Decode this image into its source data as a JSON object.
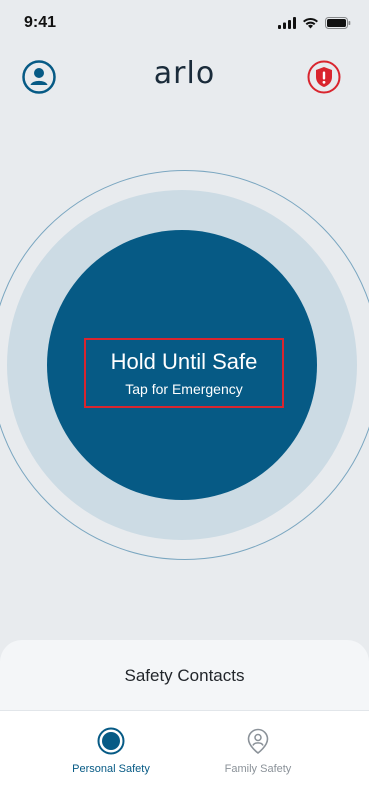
{
  "status_bar": {
    "time": "9:41"
  },
  "header": {
    "logo_text": "arlo"
  },
  "dial": {
    "title": "Hold Until Safe",
    "subtitle": "Tap for Emergency"
  },
  "contacts": {
    "title": "Safety Contacts"
  },
  "tabs": [
    {
      "label": "Personal Safety",
      "icon": "personal-safety-icon",
      "active": true
    },
    {
      "label": "Family Safety",
      "icon": "family-safety-icon",
      "active": false
    }
  ],
  "colors": {
    "background": "#e8ebee",
    "primary": "#065a85",
    "halo": "#ccdbe4",
    "emergency": "#d9252e",
    "tab_inactive": "#8b9299"
  }
}
